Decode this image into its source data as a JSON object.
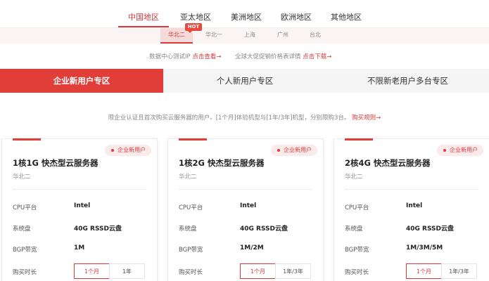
{
  "regions": [
    "中国地区",
    "亚太地区",
    "美洲地区",
    "欧洲地区",
    "其他地区"
  ],
  "subregions": [
    "华北二",
    "华北一",
    "上海",
    "广州",
    "台北"
  ],
  "hot_label": "HOT",
  "notices": [
    {
      "text": "数据中心测试IP",
      "link": "点击查看→"
    },
    {
      "text": "全球大促促销价格表详情",
      "link": "点击下载→"
    }
  ],
  "user_tabs": [
    "企业新用户专区",
    "个人新用户专区",
    "不限新老用户多台专区"
  ],
  "description": {
    "text": "限企业认证且首次购买云服务器的用户。[1个月]体验机型与[1年/3年]机型，分别限购3台。",
    "link": "购买规则→"
  },
  "spec_labels": {
    "cpu": "CPU平台",
    "disk": "系统盘",
    "bandwidth": "BGP带宽",
    "period": "购买时长"
  },
  "cards": [
    {
      "badge": "企业新用户",
      "title": "1核1G 快杰型云服务器",
      "region": "华北二",
      "cpu": "Intel",
      "disk": "40G RSSD云盘",
      "bandwidth": "1M",
      "periods": [
        "1个月",
        "1年"
      ]
    },
    {
      "badge": "企业新用户",
      "title": "1核2G 快杰型云服务器",
      "region": "华北二",
      "cpu": "Intel",
      "disk": "40G RSSD云盘",
      "bandwidth": "1M/2M",
      "periods": [
        "1个月",
        "1年/3年"
      ]
    },
    {
      "badge": "企业新用户",
      "title": "2核4G 快杰型云服务器",
      "region": "华北二",
      "cpu": "Intel",
      "disk": "40G RSSD云盘",
      "bandwidth": "1M/3M/5M",
      "periods": [
        "1个月",
        "1年/3年"
      ]
    }
  ],
  "colors": {
    "accent": "#e13d39",
    "link": "#d83a3a"
  }
}
